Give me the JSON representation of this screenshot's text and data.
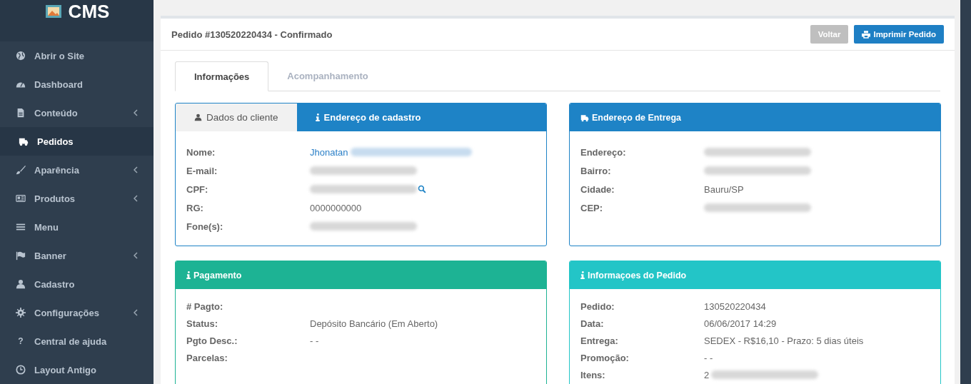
{
  "sidebar": {
    "logo": "CMS",
    "items": [
      {
        "label": "Abrir o Site",
        "kind": "globe",
        "submenu": false,
        "selected": false
      },
      {
        "label": "Dashboard",
        "kind": "dashboard",
        "submenu": false,
        "selected": false
      },
      {
        "label": "Conteúdo",
        "kind": "file",
        "submenu": true,
        "selected": false
      },
      {
        "label": "Pedidos",
        "kind": "truck",
        "submenu": false,
        "selected": true
      },
      {
        "label": "Aparência",
        "kind": "brush",
        "submenu": true,
        "selected": false
      },
      {
        "label": "Produtos",
        "kind": "newspaper",
        "submenu": true,
        "selected": false
      },
      {
        "label": "Menu",
        "kind": "bars",
        "submenu": false,
        "selected": false
      },
      {
        "label": "Banner",
        "kind": "flag",
        "submenu": true,
        "selected": false
      },
      {
        "label": "Cadastro",
        "kind": "user",
        "submenu": false,
        "selected": false
      },
      {
        "label": "Configurações",
        "kind": "gear",
        "submenu": true,
        "selected": false
      },
      {
        "label": "Central de ajuda",
        "kind": "question",
        "icon_char": "?",
        "submenu": false,
        "selected": false
      },
      {
        "label": "Layout Antigo",
        "kind": "clock",
        "submenu": false,
        "selected": false
      }
    ]
  },
  "order": {
    "title": "Pedido #130520220434 - Confirmado",
    "buttons": [
      {
        "label": "Voltar",
        "kind": "secondary"
      },
      {
        "label": "Imprimir Pedido",
        "kind": "print"
      }
    ],
    "tabs": [
      {
        "label": "Informações",
        "selected": true
      },
      {
        "label": "Acompanhamento",
        "selected": false
      }
    ],
    "panels": [
      {
        "tabs": [
          {
            "label": "Dados do cliente",
            "kind": "user",
            "selected": true
          },
          {
            "label": "Endereço de cadastro",
            "kind": "info",
            "selected": false
          }
        ],
        "color": "#1e83c6",
        "fields": [
          {
            "label": "Nome:",
            "value": "Jhonatan",
            "link": true,
            "redacted": true
          },
          {
            "label": "E-mail:",
            "redacted": true
          },
          {
            "label": "CPF:",
            "redacted": true,
            "lookup": true
          },
          {
            "label": "RG:",
            "value": "0000000000"
          },
          {
            "label": "Fone(s):",
            "redacted": true
          }
        ]
      },
      {
        "title": "Endereço de Entrega",
        "kind": "truck",
        "color": "#1e83c6",
        "fields": [
          {
            "label": "Endereço:",
            "redacted": true
          },
          {
            "label": "Bairro:",
            "redacted": true
          },
          {
            "label": "Cidade:",
            "value": "Bauru/SP"
          },
          {
            "label": "CEP:",
            "redacted": true
          }
        ]
      },
      {
        "title": "Pagamento",
        "kind": "info",
        "color": "#1db394",
        "fields": [
          {
            "label": "# Pagto:"
          },
          {
            "label": "Status:",
            "value": "Depósito Bancário (Em Aberto)"
          },
          {
            "label": "Pgto Desc.:",
            "value": "- -"
          },
          {
            "label": "Parcelas:"
          }
        ]
      },
      {
        "title": "Informaçoes do Pedido",
        "kind": "info",
        "color": "#23c5c7",
        "fields": [
          {
            "label": "Pedido:",
            "value": "130520220434"
          },
          {
            "label": "Data:",
            "value": "06/06/2017 14:29"
          },
          {
            "label": "Entrega:",
            "value": "SEDEX - R$16,10 - Prazo: 5 dias úteis"
          },
          {
            "label": "Promoção:",
            "value": "- -"
          },
          {
            "label": "Itens:",
            "value": "2",
            "redacted": true
          }
        ]
      }
    ]
  }
}
